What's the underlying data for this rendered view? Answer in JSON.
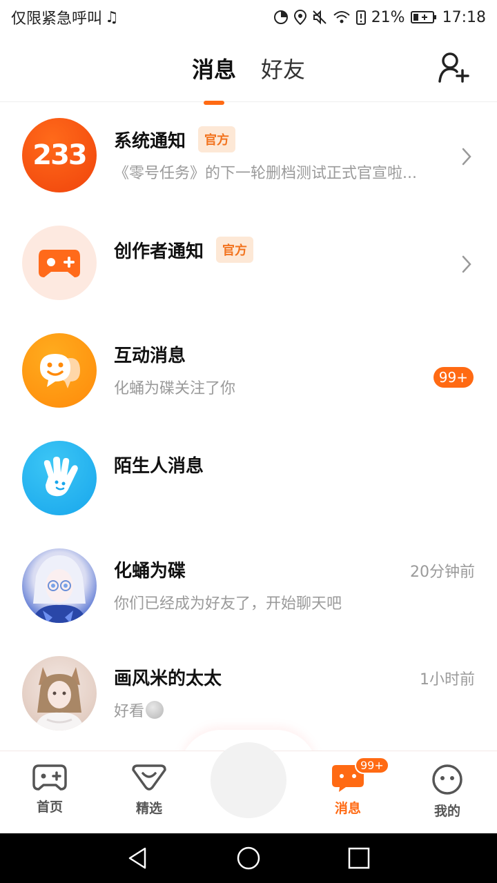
{
  "status_bar": {
    "left_text": "仅限紧急呼叫",
    "battery_percent": "21%",
    "time": "17:18"
  },
  "header": {
    "tabs": [
      {
        "label": "消息",
        "active": true
      },
      {
        "label": "好友",
        "active": false
      }
    ]
  },
  "messages": [
    {
      "title": "系统通知",
      "tag": "官方",
      "subtitle": "《零号任务》的下一轮删档测试正式官宣啦...",
      "avatar_text": "233"
    },
    {
      "title": "创作者通知",
      "tag": "官方",
      "subtitle": ""
    },
    {
      "title": "互动消息",
      "subtitle": "化蛹为碟关注了你",
      "badge": "99+"
    },
    {
      "title": "陌生人消息",
      "subtitle": ""
    },
    {
      "title": "化蛹为碟",
      "subtitle": "你们已经成为好友了，开始聊天吧",
      "time": "20分钟前"
    },
    {
      "title": "画风米的太太",
      "subtitle": "好看",
      "time": "1小时前"
    }
  ],
  "bottom_nav": {
    "items": [
      {
        "label": "首页",
        "icon": "gamepad-icon"
      },
      {
        "label": "精选",
        "icon": "heart-chat-icon"
      },
      {
        "label": "消息",
        "icon": "message-icon",
        "active": true,
        "badge": "99+"
      },
      {
        "label": "我的",
        "icon": "face-icon"
      }
    ]
  },
  "colors": {
    "accent": "#ff6a13",
    "tag_bg": "#fde8d6",
    "tag_text": "#f2731e"
  }
}
